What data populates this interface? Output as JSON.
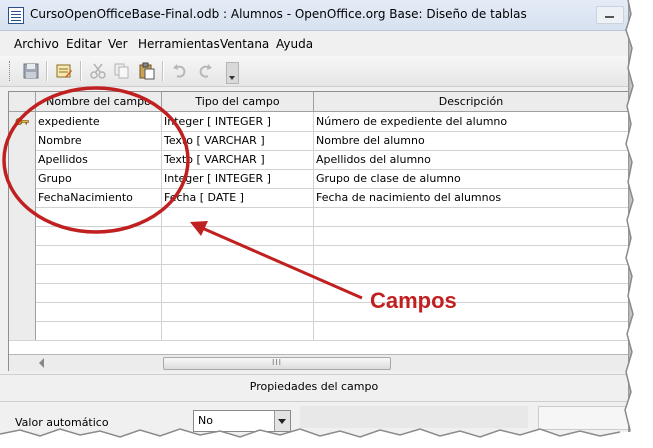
{
  "window": {
    "title": "CursoOpenOfficeBase-Final.odb : Alumnos - OpenOffice.org Base: Diseño de tablas"
  },
  "menu": {
    "items": [
      "Archivo",
      "Editar",
      "Ver",
      "Herramientas",
      "Ventana",
      "Ayuda"
    ]
  },
  "table": {
    "headers": {
      "name": "Nombre del campo",
      "type": "Tipo del campo",
      "description": "Descripción"
    },
    "rows": [
      {
        "name": "expediente",
        "type": "Integer [ INTEGER ]",
        "description": "Número de expediente del alumno",
        "primary_key": true
      },
      {
        "name": "Nombre",
        "type": "Texto [ VARCHAR ]",
        "description": "Nombre del alumno",
        "primary_key": false
      },
      {
        "name": "Apellidos",
        "type": "Texto [ VARCHAR ]",
        "description": "Apellidos del alumno",
        "primary_key": false
      },
      {
        "name": "Grupo",
        "type": "Integer [ INTEGER ]",
        "description": "Grupo de clase de alumno",
        "primary_key": false
      },
      {
        "name": "FechaNacimiento",
        "type": "Fecha [ DATE ]",
        "description": "Fecha de nacimiento del alumnos",
        "primary_key": false
      }
    ],
    "scroll_grip": "III"
  },
  "properties": {
    "title": "Propiedades del campo",
    "autovalue_label": "Valor automático",
    "autovalue_value": "No"
  },
  "annotation": {
    "label": "Campos",
    "color": "#c0201f"
  },
  "icons": {
    "toolbar": [
      "save-icon",
      "edit-design-icon",
      "cut-icon",
      "copy-icon",
      "paste-icon",
      "undo-icon",
      "redo-icon"
    ],
    "primary_key": "key-icon"
  }
}
